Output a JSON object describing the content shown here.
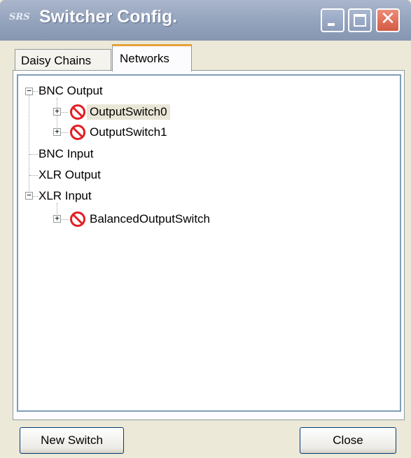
{
  "window": {
    "logo": "SRS",
    "title": "Switcher Config.",
    "colors": {
      "titlebar": "#97a6bf",
      "close": "#d15b45",
      "tab_highlight": "#e6a13b"
    }
  },
  "tabs": [
    {
      "label": "Daisy Chains",
      "active": false
    },
    {
      "label": "Networks",
      "active": true
    }
  ],
  "tree": {
    "nodes": [
      {
        "label": "BNC Output",
        "expanded": true
      },
      {
        "label": "OutputSwitch0",
        "status_icon": "no-entry-icon",
        "selected": true
      },
      {
        "label": "OutputSwitch1",
        "status_icon": "no-entry-icon"
      },
      {
        "label": "BNC Input"
      },
      {
        "label": "XLR Output"
      },
      {
        "label": "XLR Input",
        "expanded": true
      },
      {
        "label": "BalancedOutputSwitch",
        "status_icon": "no-entry-icon"
      }
    ]
  },
  "buttons": {
    "new_switch": "New Switch",
    "close": "Close"
  }
}
